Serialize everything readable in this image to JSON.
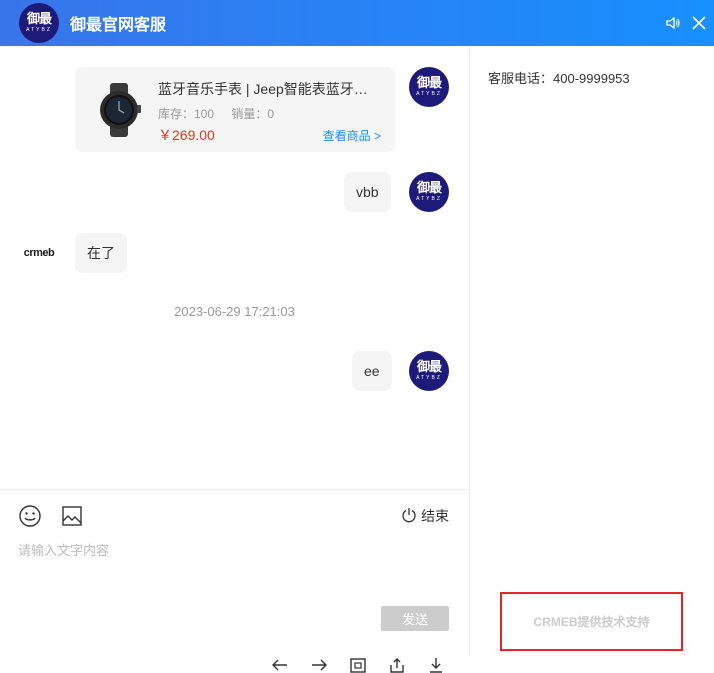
{
  "header": {
    "logo": {
      "main": "御最",
      "sub": "ATYBZ"
    },
    "title": "御最官网客服",
    "icons": [
      "speaker-icon",
      "close-icon"
    ]
  },
  "side_panel": {
    "phone": "客服电话：400-9999953"
  },
  "messages": {
    "product": {
      "name": "蓝牙音乐手表 | Jeep智能表蓝牙音乐手表 运动手表",
      "stock_label": "库存：100",
      "sales_label": "销量：0",
      "price": "￥269.00",
      "link": "查看商品 >"
    },
    "user_text_1": "vbb",
    "agent_logo": "crmeb",
    "agent_text": "在了",
    "timestamp": "2023-06-29 17:21:03",
    "user_text_2": "ee"
  },
  "input": {
    "placeholder": "请输入文字内容",
    "end_label": "结束",
    "send_label": "发送",
    "icons": [
      "emoji-icon",
      "image-icon",
      "power-icon"
    ]
  },
  "footer": {
    "support": "CRMEB提供技术支持"
  },
  "nav": {
    "icons": [
      "arrow-left-icon",
      "arrow-right-icon",
      "refresh-icon",
      "share-icon",
      "download-icon"
    ]
  },
  "colors": {
    "header_start": "#3875ea",
    "header_end": "#1890ff",
    "price": "#e93323",
    "link": "#1890ff",
    "highlight_border": "#e4262a",
    "avatar_bg": "#1e1a7a"
  }
}
